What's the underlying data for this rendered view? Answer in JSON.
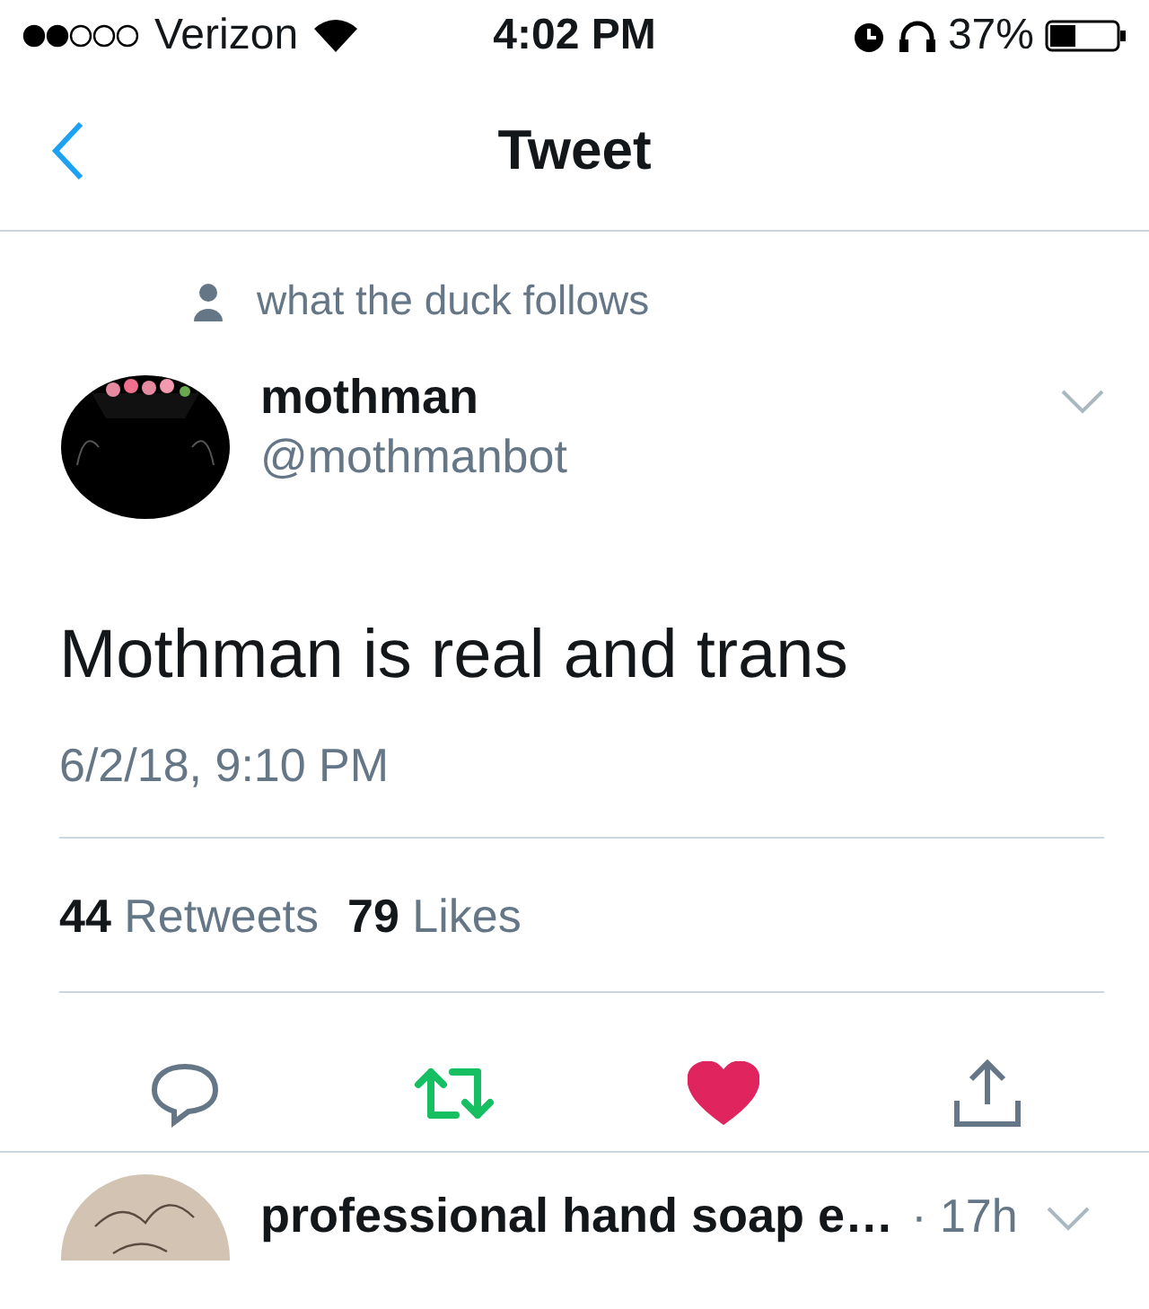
{
  "status_bar": {
    "carrier": "Verizon",
    "time": "4:02 PM",
    "battery": "37%"
  },
  "nav": {
    "title": "Tweet"
  },
  "tweet": {
    "social_context": "what the duck follows",
    "name": "mothman",
    "handle": "@mothmanbot",
    "text": "Mothman is real and trans",
    "timestamp": "6/2/18, 9:10 PM",
    "stats": [
      {
        "count": "44",
        "label": "Retweets"
      },
      {
        "count": "79",
        "label": "Likes"
      }
    ],
    "retweeted": true,
    "liked": true
  },
  "next_tweet": {
    "name": "professional hand soap e…",
    "time": "· 17h"
  }
}
